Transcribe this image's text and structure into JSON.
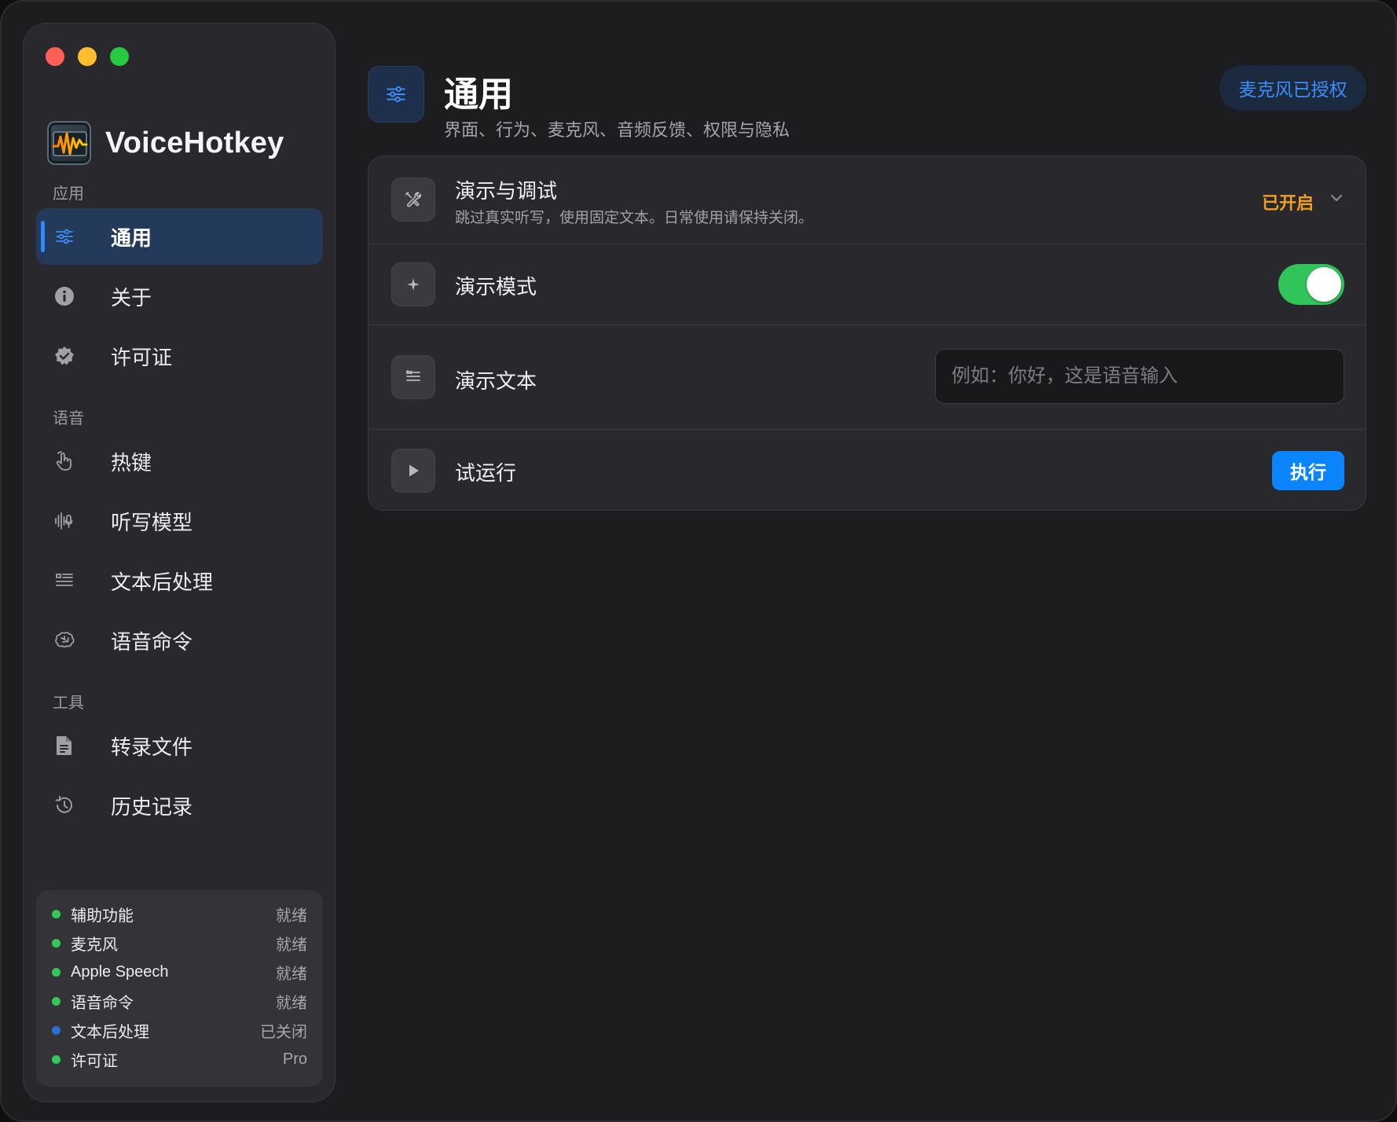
{
  "app": {
    "name": "VoiceHotkey"
  },
  "sidebar": {
    "sections": [
      {
        "label": "应用",
        "items": [
          {
            "label": "通用",
            "icon": "sliders-icon",
            "active": true
          },
          {
            "label": "关于",
            "icon": "info-icon",
            "active": false
          },
          {
            "label": "许可证",
            "icon": "verified-badge-icon",
            "active": false
          }
        ]
      },
      {
        "label": "语音",
        "items": [
          {
            "label": "热键",
            "icon": "hand-pointer-icon",
            "active": false
          },
          {
            "label": "听写模型",
            "icon": "waveform-mic-icon",
            "active": false
          },
          {
            "label": "文本后处理",
            "icon": "text-format-icon",
            "active": false
          },
          {
            "label": "语音命令",
            "icon": "brain-icon",
            "active": false
          }
        ]
      },
      {
        "label": "工具",
        "items": [
          {
            "label": "转录文件",
            "icon": "document-icon",
            "active": false
          },
          {
            "label": "历史记录",
            "icon": "history-icon",
            "active": false
          }
        ]
      }
    ],
    "status": [
      {
        "name": "辅助功能",
        "value": "就绪",
        "color": "#32c85a"
      },
      {
        "name": "麦克风",
        "value": "就绪",
        "color": "#32c85a"
      },
      {
        "name": "Apple Speech",
        "value": "就绪",
        "color": "#32c85a"
      },
      {
        "name": "语音命令",
        "value": "就绪",
        "color": "#32c85a"
      },
      {
        "name": "文本后处理",
        "value": "已关闭",
        "color": "#2a6fd6"
      },
      {
        "name": "许可证",
        "value": "Pro",
        "color": "#32c85a"
      }
    ]
  },
  "header": {
    "title": "通用",
    "subtitle": "界面、行为、麦克风、音频反馈、权限与隐私",
    "badge": "麦克风已授权"
  },
  "card": {
    "section": {
      "title": "演示与调试",
      "subtitle": "跳过真实听写，使用固定文本。日常使用请保持关闭。",
      "status": "已开启"
    },
    "demo_mode": {
      "label": "演示模式",
      "enabled": true
    },
    "demo_text": {
      "label": "演示文本",
      "value": "",
      "placeholder": "例如：你好，这是语音输入"
    },
    "trial_run": {
      "label": "试运行",
      "button": "执行"
    }
  },
  "colors": {
    "accent": "#0a84ff",
    "success": "#30c45a",
    "warning": "#f0a020"
  }
}
